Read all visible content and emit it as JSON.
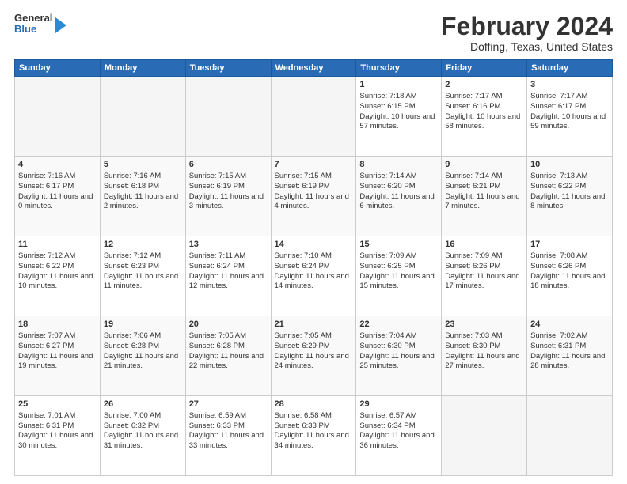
{
  "app": {
    "logo_line1": "General",
    "logo_line2": "Blue"
  },
  "header": {
    "title": "February 2024",
    "subtitle": "Doffing, Texas, United States"
  },
  "calendar": {
    "days_of_week": [
      "Sunday",
      "Monday",
      "Tuesday",
      "Wednesday",
      "Thursday",
      "Friday",
      "Saturday"
    ],
    "weeks": [
      [
        {
          "day": "",
          "sunrise": "",
          "sunset": "",
          "daylight": "",
          "empty": true
        },
        {
          "day": "",
          "sunrise": "",
          "sunset": "",
          "daylight": "",
          "empty": true
        },
        {
          "day": "",
          "sunrise": "",
          "sunset": "",
          "daylight": "",
          "empty": true
        },
        {
          "day": "",
          "sunrise": "",
          "sunset": "",
          "daylight": "",
          "empty": true
        },
        {
          "day": "1",
          "sunrise": "Sunrise: 7:18 AM",
          "sunset": "Sunset: 6:15 PM",
          "daylight": "Daylight: 10 hours and 57 minutes.",
          "empty": false
        },
        {
          "day": "2",
          "sunrise": "Sunrise: 7:17 AM",
          "sunset": "Sunset: 6:16 PM",
          "daylight": "Daylight: 10 hours and 58 minutes.",
          "empty": false
        },
        {
          "day": "3",
          "sunrise": "Sunrise: 7:17 AM",
          "sunset": "Sunset: 6:17 PM",
          "daylight": "Daylight: 10 hours and 59 minutes.",
          "empty": false
        }
      ],
      [
        {
          "day": "4",
          "sunrise": "Sunrise: 7:16 AM",
          "sunset": "Sunset: 6:17 PM",
          "daylight": "Daylight: 11 hours and 0 minutes.",
          "empty": false
        },
        {
          "day": "5",
          "sunrise": "Sunrise: 7:16 AM",
          "sunset": "Sunset: 6:18 PM",
          "daylight": "Daylight: 11 hours and 2 minutes.",
          "empty": false
        },
        {
          "day": "6",
          "sunrise": "Sunrise: 7:15 AM",
          "sunset": "Sunset: 6:19 PM",
          "daylight": "Daylight: 11 hours and 3 minutes.",
          "empty": false
        },
        {
          "day": "7",
          "sunrise": "Sunrise: 7:15 AM",
          "sunset": "Sunset: 6:19 PM",
          "daylight": "Daylight: 11 hours and 4 minutes.",
          "empty": false
        },
        {
          "day": "8",
          "sunrise": "Sunrise: 7:14 AM",
          "sunset": "Sunset: 6:20 PM",
          "daylight": "Daylight: 11 hours and 6 minutes.",
          "empty": false
        },
        {
          "day": "9",
          "sunrise": "Sunrise: 7:14 AM",
          "sunset": "Sunset: 6:21 PM",
          "daylight": "Daylight: 11 hours and 7 minutes.",
          "empty": false
        },
        {
          "day": "10",
          "sunrise": "Sunrise: 7:13 AM",
          "sunset": "Sunset: 6:22 PM",
          "daylight": "Daylight: 11 hours and 8 minutes.",
          "empty": false
        }
      ],
      [
        {
          "day": "11",
          "sunrise": "Sunrise: 7:12 AM",
          "sunset": "Sunset: 6:22 PM",
          "daylight": "Daylight: 11 hours and 10 minutes.",
          "empty": false
        },
        {
          "day": "12",
          "sunrise": "Sunrise: 7:12 AM",
          "sunset": "Sunset: 6:23 PM",
          "daylight": "Daylight: 11 hours and 11 minutes.",
          "empty": false
        },
        {
          "day": "13",
          "sunrise": "Sunrise: 7:11 AM",
          "sunset": "Sunset: 6:24 PM",
          "daylight": "Daylight: 11 hours and 12 minutes.",
          "empty": false
        },
        {
          "day": "14",
          "sunrise": "Sunrise: 7:10 AM",
          "sunset": "Sunset: 6:24 PM",
          "daylight": "Daylight: 11 hours and 14 minutes.",
          "empty": false
        },
        {
          "day": "15",
          "sunrise": "Sunrise: 7:09 AM",
          "sunset": "Sunset: 6:25 PM",
          "daylight": "Daylight: 11 hours and 15 minutes.",
          "empty": false
        },
        {
          "day": "16",
          "sunrise": "Sunrise: 7:09 AM",
          "sunset": "Sunset: 6:26 PM",
          "daylight": "Daylight: 11 hours and 17 minutes.",
          "empty": false
        },
        {
          "day": "17",
          "sunrise": "Sunrise: 7:08 AM",
          "sunset": "Sunset: 6:26 PM",
          "daylight": "Daylight: 11 hours and 18 minutes.",
          "empty": false
        }
      ],
      [
        {
          "day": "18",
          "sunrise": "Sunrise: 7:07 AM",
          "sunset": "Sunset: 6:27 PM",
          "daylight": "Daylight: 11 hours and 19 minutes.",
          "empty": false
        },
        {
          "day": "19",
          "sunrise": "Sunrise: 7:06 AM",
          "sunset": "Sunset: 6:28 PM",
          "daylight": "Daylight: 11 hours and 21 minutes.",
          "empty": false
        },
        {
          "day": "20",
          "sunrise": "Sunrise: 7:05 AM",
          "sunset": "Sunset: 6:28 PM",
          "daylight": "Daylight: 11 hours and 22 minutes.",
          "empty": false
        },
        {
          "day": "21",
          "sunrise": "Sunrise: 7:05 AM",
          "sunset": "Sunset: 6:29 PM",
          "daylight": "Daylight: 11 hours and 24 minutes.",
          "empty": false
        },
        {
          "day": "22",
          "sunrise": "Sunrise: 7:04 AM",
          "sunset": "Sunset: 6:30 PM",
          "daylight": "Daylight: 11 hours and 25 minutes.",
          "empty": false
        },
        {
          "day": "23",
          "sunrise": "Sunrise: 7:03 AM",
          "sunset": "Sunset: 6:30 PM",
          "daylight": "Daylight: 11 hours and 27 minutes.",
          "empty": false
        },
        {
          "day": "24",
          "sunrise": "Sunrise: 7:02 AM",
          "sunset": "Sunset: 6:31 PM",
          "daylight": "Daylight: 11 hours and 28 minutes.",
          "empty": false
        }
      ],
      [
        {
          "day": "25",
          "sunrise": "Sunrise: 7:01 AM",
          "sunset": "Sunset: 6:31 PM",
          "daylight": "Daylight: 11 hours and 30 minutes.",
          "empty": false
        },
        {
          "day": "26",
          "sunrise": "Sunrise: 7:00 AM",
          "sunset": "Sunset: 6:32 PM",
          "daylight": "Daylight: 11 hours and 31 minutes.",
          "empty": false
        },
        {
          "day": "27",
          "sunrise": "Sunrise: 6:59 AM",
          "sunset": "Sunset: 6:33 PM",
          "daylight": "Daylight: 11 hours and 33 minutes.",
          "empty": false
        },
        {
          "day": "28",
          "sunrise": "Sunrise: 6:58 AM",
          "sunset": "Sunset: 6:33 PM",
          "daylight": "Daylight: 11 hours and 34 minutes.",
          "empty": false
        },
        {
          "day": "29",
          "sunrise": "Sunrise: 6:57 AM",
          "sunset": "Sunset: 6:34 PM",
          "daylight": "Daylight: 11 hours and 36 minutes.",
          "empty": false
        },
        {
          "day": "",
          "sunrise": "",
          "sunset": "",
          "daylight": "",
          "empty": true
        },
        {
          "day": "",
          "sunrise": "",
          "sunset": "",
          "daylight": "",
          "empty": true
        }
      ]
    ]
  }
}
